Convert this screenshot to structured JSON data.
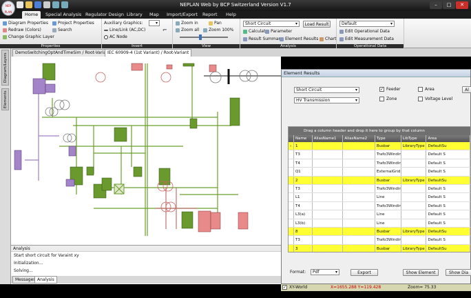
{
  "window": {
    "title": "NEPLAN Web by BCP Switzerland Version V1.7",
    "logo_text": "NEP PLAN"
  },
  "ribbon": {
    "tabs": [
      "Home",
      "Special Analysis",
      "Regulator Design",
      "Library",
      "Map",
      "Import/Export",
      "Report",
      "Help"
    ],
    "properties": {
      "label": "Properties",
      "diagram_properties": "Diagram Properties",
      "project_properties": "Project Properties",
      "redraw": "Redraw (Colors)",
      "search": "Search",
      "change_graphic_layer": "Change Graphic Layer"
    },
    "insert": {
      "label": "Insert",
      "auxiliary_graphics": "Auxiliary Graphics:",
      "line_link": "Line/Link (AC,DC)",
      "ac_node": "AC Node"
    },
    "view": {
      "label": "View",
      "zoom_in": "Zoom in",
      "pan": "Pan",
      "zoom_all": "Zoom all",
      "zoom_100": "Zoom 100%"
    },
    "analysis": {
      "label": "Analysis",
      "selected": "Short Circuit",
      "load_result": "Load Result",
      "calculate": "Calculate",
      "parameter": "Parameter",
      "result_summary": "Result Summary",
      "element_results": "Element Results",
      "chart": "Chart"
    },
    "operational": {
      "label": "Operational Data",
      "selected": "Default",
      "edit_operational": "Edit Operational Data",
      "edit_measurement": "Edit Measurement Data"
    }
  },
  "left_dock": {
    "tabs": [
      "Diagram/Layers",
      "Elements"
    ]
  },
  "doc_tabs": [
    "DemoSwitchingOptAndTimeSim / Root-Variant",
    "IEC 60909-4 (1st Variant) / Root-Variant"
  ],
  "analysis_panel": {
    "header": "Analysis",
    "lines": [
      "Start short circuit for Varaint xy",
      "Initialization...",
      "Solving..."
    ],
    "tabs": [
      "Messages",
      "Analysis"
    ]
  },
  "element_results": {
    "title": "Element Results",
    "analysis_select": "Short Circuit",
    "transmission_select": "HV Transmission",
    "checks": [
      {
        "label": "Feeder",
        "checked": true
      },
      {
        "label": "Area",
        "checked": false
      },
      {
        "label": "Zone",
        "checked": false
      },
      {
        "label": "Voltage Level",
        "checked": false
      }
    ],
    "group_hint": "Drag a column header and drop it here to group by that column",
    "columns": [
      "Name",
      "AliasName1",
      "AliasName2",
      "Type",
      "LibType",
      "Area"
    ],
    "rows": [
      {
        "name": "1",
        "type": "Busbar",
        "lib": "LibraryType",
        "area": "DefaultSu",
        "highlight": true
      },
      {
        "name": "T3",
        "type": "Trafo3Winding",
        "lib": "",
        "area": "Default S",
        "highlight": false
      },
      {
        "name": "T4",
        "type": "Trafo3Winding",
        "lib": "",
        "area": "Default S",
        "highlight": false
      },
      {
        "name": "Q1",
        "type": "ExternalGrid",
        "lib": "",
        "area": "Default S",
        "highlight": false
      },
      {
        "name": "2",
        "type": "Busbar",
        "lib": "LibraryType",
        "area": "DefaultSu",
        "highlight": true
      },
      {
        "name": "T3",
        "type": "Trafo3Winding",
        "lib": "",
        "area": "Default S",
        "highlight": false
      },
      {
        "name": "L1",
        "type": "Line",
        "lib": "",
        "area": "Default S",
        "highlight": false
      },
      {
        "name": "T4",
        "type": "Trafo3Winding",
        "lib": "",
        "area": "Default S",
        "highlight": false
      },
      {
        "name": "L3(a)",
        "type": "Line",
        "lib": "",
        "area": "Default S",
        "highlight": false
      },
      {
        "name": "L3(b)",
        "type": "Line",
        "lib": "",
        "area": "Default S",
        "highlight": false
      },
      {
        "name": "8",
        "type": "Busbar",
        "lib": "LibraryType",
        "area": "DefaultSu",
        "highlight": true
      },
      {
        "name": "T3",
        "type": "Trafo3Winding",
        "lib": "",
        "area": "Default S",
        "highlight": false
      },
      {
        "name": "3",
        "type": "Busbar",
        "lib": "LibraryType",
        "area": "DefaultSu",
        "highlight": true
      }
    ],
    "format_label": "Format:",
    "format_value": "Pdf",
    "export": "Export",
    "show_element": "Show Element",
    "show_diagram": "Show Dia"
  },
  "status_bar": {
    "layer": "XY-World",
    "coords": "X=1655.288 Y=119.428",
    "zoom": "Zoom= 75.33"
  }
}
